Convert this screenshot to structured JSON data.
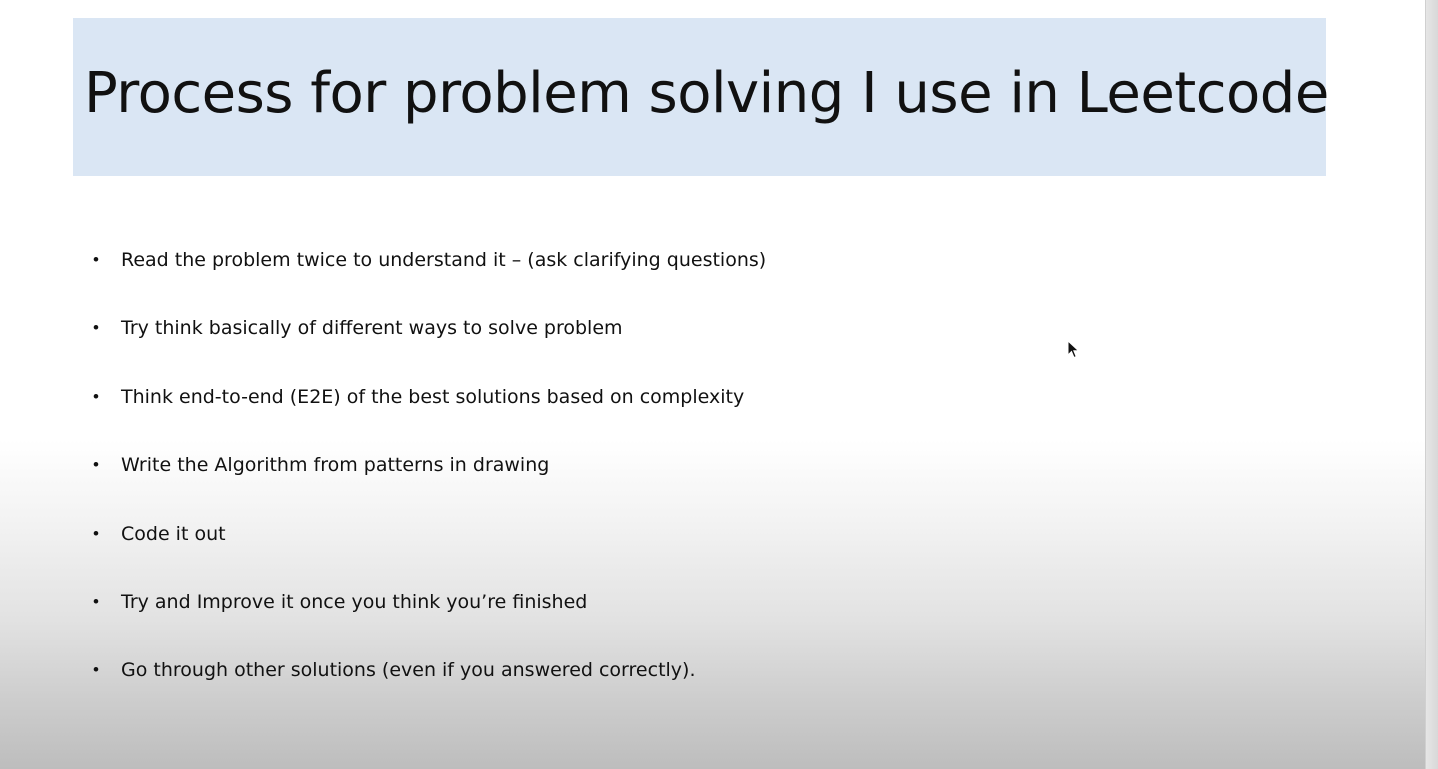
{
  "slide": {
    "title": "Process for problem solving I use in Leetcode",
    "bullet_char": "•",
    "bullets": [
      "Read the problem twice to understand it – (ask clarifying questions)",
      "Try think basically of different ways to solve problem",
      "Think end-to-end (E2E) of the best solutions based on complexity",
      "Write the Algorithm from patterns in drawing",
      "Code it out",
      "Try and Improve it once you think you’re finished",
      "Go through other solutions (even if you answered correctly)."
    ]
  },
  "colors": {
    "title_background": "#dae6f4",
    "text": "#111111"
  },
  "icons": {
    "cursor": "mouse-pointer-icon"
  }
}
